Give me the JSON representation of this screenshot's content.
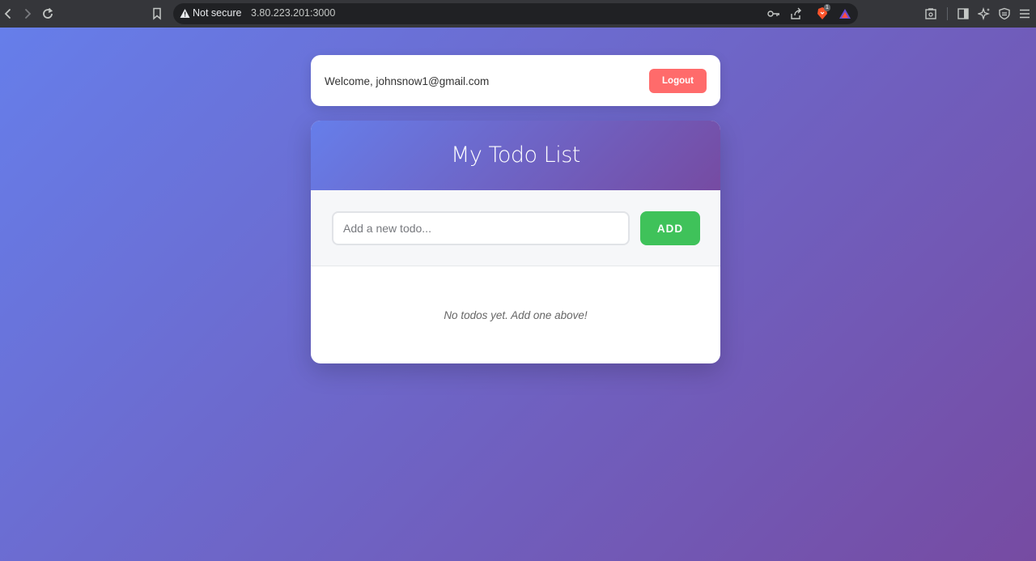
{
  "browser": {
    "security_label": "Not secure",
    "url": "3.80.223.201:3000",
    "brave_badge_count": "1"
  },
  "header": {
    "welcome_text": "Welcome, johnsnow1@gmail.com",
    "logout_label": "Logout"
  },
  "todo": {
    "title": "My Todo List",
    "input_value": "",
    "input_placeholder": "Add a new todo...",
    "add_label": "ADD",
    "empty_message": "No todos yet. Add one above!",
    "items": []
  },
  "colors": {
    "gradient_start": "#667eea",
    "gradient_end": "#764ba2",
    "logout": "#ff6b6b",
    "add": "#3fc25a"
  },
  "icons": {
    "back": "back-arrow-icon",
    "forward": "forward-arrow-icon",
    "reload": "reload-icon",
    "bookmark": "bookmark-icon",
    "warning": "warning-icon",
    "key": "key-icon",
    "share": "share-icon",
    "brave": "brave-shields-icon",
    "rewards": "brave-rewards-icon",
    "screenshot": "screenshot-icon",
    "sidebar": "sidebar-icon",
    "leo": "leo-ai-icon",
    "vpn": "vpn-shield-icon",
    "menu": "hamburger-menu-icon"
  }
}
